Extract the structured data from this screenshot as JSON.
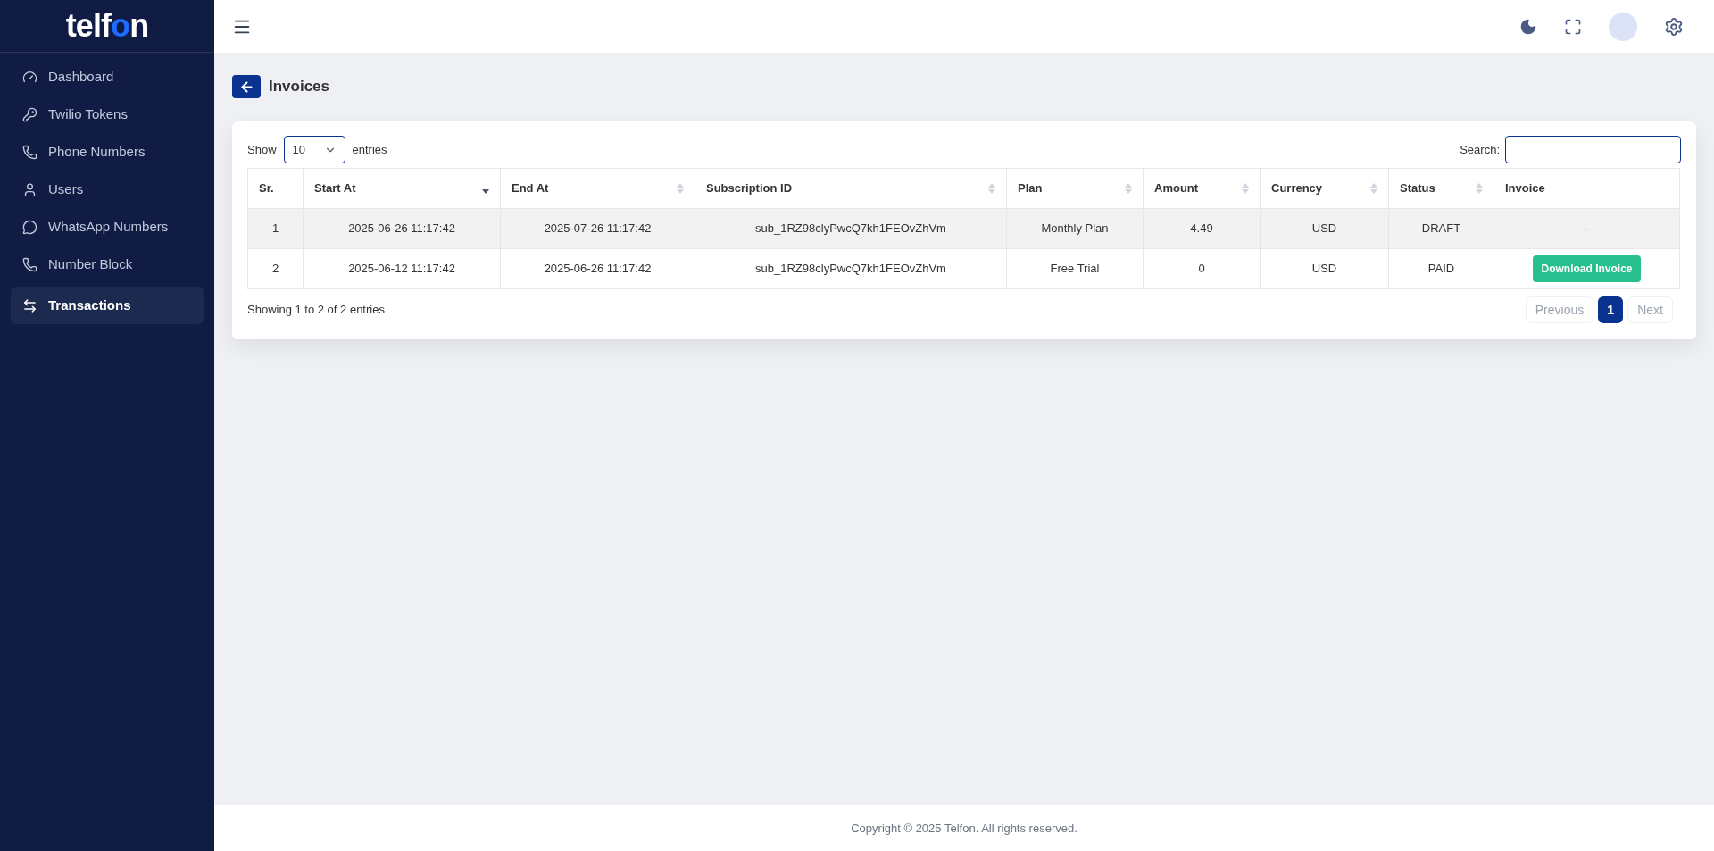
{
  "logo": {
    "start": "telf",
    "accent": "o",
    "end": "n"
  },
  "sidebar": {
    "items": [
      {
        "label": "Dashboard",
        "selected": false
      },
      {
        "label": "Twilio Tokens",
        "selected": false
      },
      {
        "label": "Phone Numbers",
        "selected": false
      },
      {
        "label": "Users",
        "selected": false
      },
      {
        "label": "WhatsApp Numbers",
        "selected": false
      },
      {
        "label": "Number Block",
        "selected": false
      },
      {
        "label": "Transactions",
        "selected": true
      }
    ]
  },
  "page_title": "Invoices",
  "table_controls": {
    "show_label": "Show",
    "page_size": "10",
    "entries_label": "entries",
    "search_label": "Search:"
  },
  "table": {
    "columns": [
      {
        "label": "Sr.",
        "sortable": false
      },
      {
        "label": "Start At",
        "sortable": true,
        "sorted": true
      },
      {
        "label": "End At",
        "sortable": true,
        "sorted": false
      },
      {
        "label": "Subscription ID",
        "sortable": true,
        "sorted": false
      },
      {
        "label": "Plan",
        "sortable": true,
        "sorted": false
      },
      {
        "label": "Amount",
        "sortable": true,
        "sorted": false
      },
      {
        "label": "Currency",
        "sortable": true,
        "sorted": false
      },
      {
        "label": "Status",
        "sortable": true,
        "sorted": false
      },
      {
        "label": "Invoice",
        "sortable": false
      }
    ],
    "rows": [
      {
        "cells": [
          "1",
          "2025-06-26 11:17:42",
          "2025-07-26 11:17:42",
          "sub_1RZ98clyPwcQ7kh1FEOvZhVm",
          "Monthly Plan",
          "4.49",
          "USD",
          "DRAFT"
        ],
        "invoice": {
          "kind": "text",
          "label": "-"
        }
      },
      {
        "cells": [
          "2",
          "2025-06-12 11:17:42",
          "2025-06-26 11:17:42",
          "sub_1RZ98clyPwcQ7kh1FEOvZhVm",
          "Free Trial",
          "0",
          "USD",
          "PAID"
        ],
        "invoice": {
          "kind": "button",
          "label": "Download Invoice"
        }
      }
    ]
  },
  "table_info": "Showing 1 to 2 of 2 entries",
  "pagination": {
    "previous": {
      "label": "Previous",
      "disabled": true
    },
    "pages": [
      {
        "label": "1",
        "selected": true
      }
    ],
    "next": {
      "label": "Next",
      "disabled": true
    }
  },
  "footer": "Copyright © 2025 Telfon. All rights reserved."
}
